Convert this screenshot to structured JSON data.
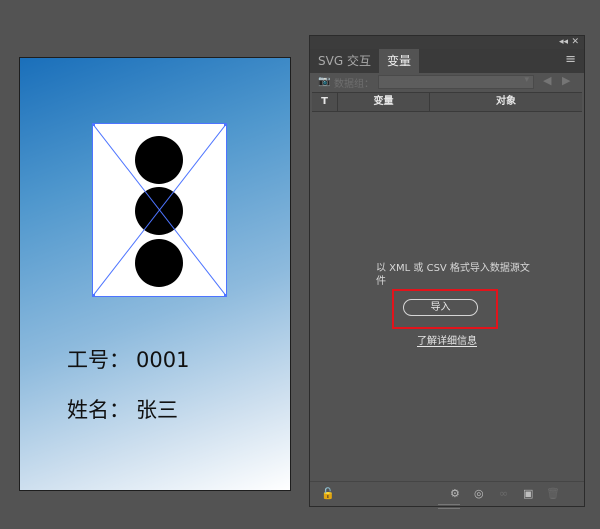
{
  "artboard": {
    "fields": [
      {
        "label": "工号：",
        "value": "0001"
      },
      {
        "label": "姓名：",
        "value": "张三"
      }
    ]
  },
  "panel": {
    "collapse_icon": "double-chevron-icon",
    "close_icon": "close-icon",
    "tabs": [
      {
        "label": "SVG 交互",
        "active": false
      },
      {
        "label": "变量",
        "active": true
      }
    ],
    "menu_icon": "hamburger-menu-icon",
    "dataset_label": "数据组：",
    "columns": [
      "T",
      "变量",
      "对象"
    ],
    "empty_message": "以 XML 或 CSV 格式导入数据源文件",
    "import_label": "导入",
    "learn_more": "了解详细信息",
    "accent_color": "#e3131b"
  }
}
